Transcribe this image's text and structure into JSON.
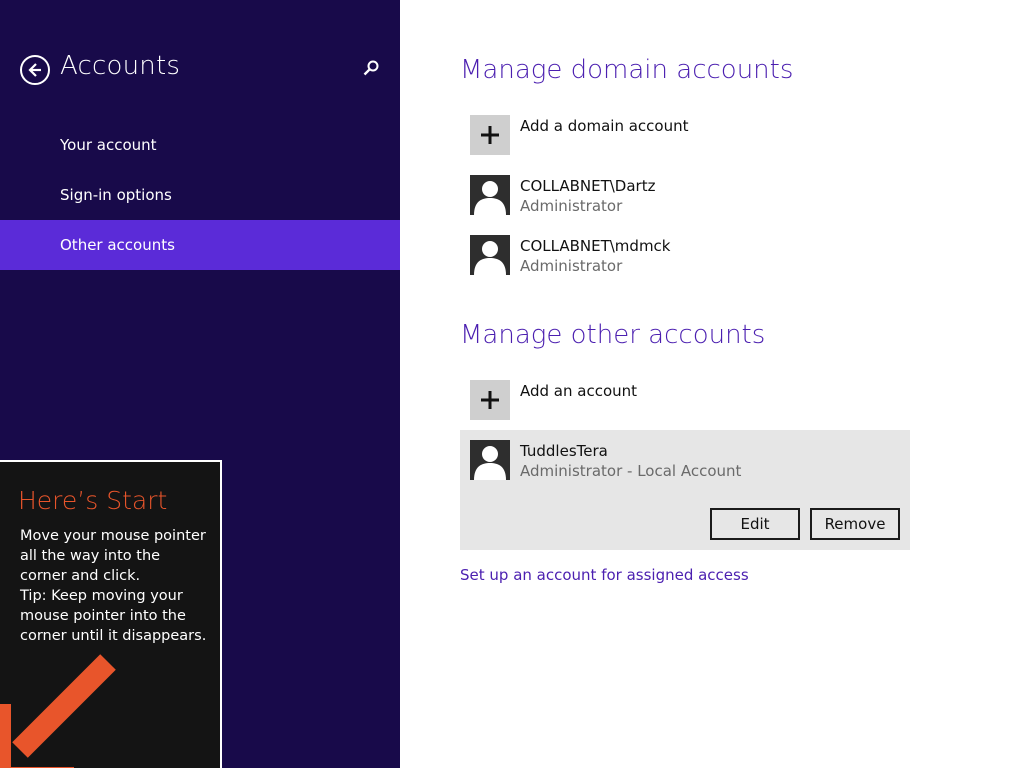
{
  "sidebar": {
    "title": "Accounts",
    "back_icon": "back-arrow-icon",
    "search_icon": "search-icon",
    "items": [
      {
        "label": "Your account"
      },
      {
        "label": "Sign-in options"
      },
      {
        "label": "Other accounts",
        "active": true
      }
    ]
  },
  "tip": {
    "title": "Here’s Start",
    "body": "Move your mouse pointer all the way into the corner and click.\nTip: Keep moving your mouse pointer into the corner until it disappears.",
    "arrow_icon": "corner-arrow-icon"
  },
  "domain_section": {
    "title": "Manage domain accounts",
    "add_label": "Add a domain account",
    "accounts": [
      {
        "name": "COLLABNET\\Dartz",
        "role": "Administrator"
      },
      {
        "name": "COLLABNET\\mdmck",
        "role": "Administrator"
      }
    ]
  },
  "other_section": {
    "title": "Manage other accounts",
    "add_label": "Add an account",
    "accounts": [
      {
        "name": "TuddlesTera",
        "role": "Administrator - Local Account",
        "selected": true
      }
    ],
    "edit_label": "Edit",
    "remove_label": "Remove"
  },
  "assigned_access_link": "Set up an account for assigned access",
  "colors": {
    "sidebar_bg": "#180a4a",
    "nav_active": "#5b2bd8",
    "accent_text": "#4b1fb0",
    "tip_title": "#e8552b"
  }
}
